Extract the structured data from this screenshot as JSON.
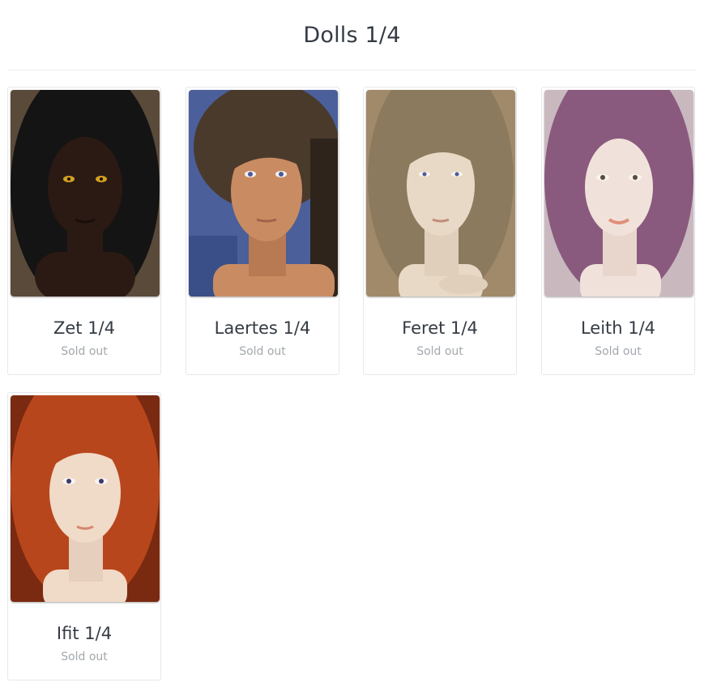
{
  "page": {
    "title": "Dolls 1/4"
  },
  "products": [
    {
      "name": "Zet 1/4",
      "status": "Sold out",
      "hair_color": "#141414",
      "skin_color": "#2b1a14",
      "bg_color": "#5a4a3a"
    },
    {
      "name": "Laertes 1/4",
      "status": "Sold out",
      "hair_color": "#4a3a2c",
      "skin_color": "#c98c62",
      "bg_color": "#4b5f9a"
    },
    {
      "name": "Feret 1/4",
      "status": "Sold out",
      "hair_color": "#8c7a5e",
      "skin_color": "#e8d9c6",
      "bg_color": "#a18a6a"
    },
    {
      "name": "Leith 1/4",
      "status": "Sold out",
      "hair_color": "#8a5a7e",
      "skin_color": "#f0e2da",
      "bg_color": "#c9b9bf"
    },
    {
      "name": "Ifit 1/4",
      "status": "Sold out",
      "hair_color": "#b8461c",
      "skin_color": "#f0dac8",
      "bg_color": "#7a2a10"
    }
  ]
}
